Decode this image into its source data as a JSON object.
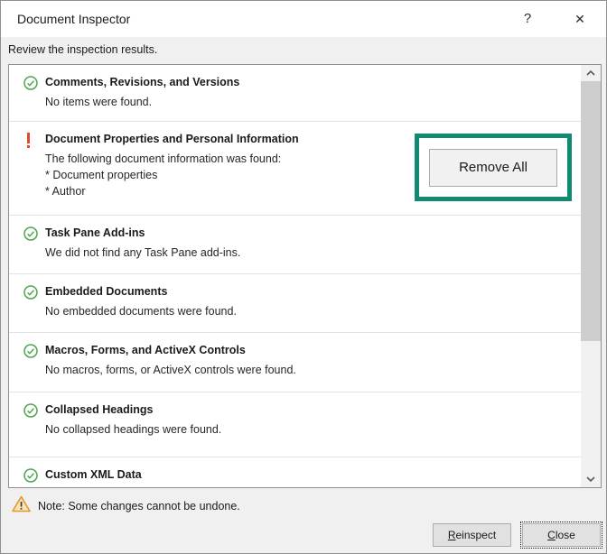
{
  "dialog": {
    "title": "Document Inspector",
    "help_label": "?",
    "close_label": "✕",
    "subtitle": "Review the inspection results."
  },
  "results": [
    {
      "status": "success",
      "title": "Comments, Revisions, and Versions",
      "lines": [
        "No items were found."
      ]
    },
    {
      "status": "alert",
      "title": "Document Properties and Personal Information",
      "lines": [
        "The following document information was found:",
        "* Document properties",
        "* Author"
      ],
      "action_label": "Remove All",
      "highlighted": true
    },
    {
      "status": "success",
      "title": "Task Pane Add-ins",
      "lines": [
        "We did not find any Task Pane add-ins."
      ]
    },
    {
      "status": "success",
      "title": "Embedded Documents",
      "lines": [
        "No embedded documents were found."
      ]
    },
    {
      "status": "success",
      "title": "Macros, Forms, and ActiveX Controls",
      "lines": [
        "No macros, forms, or ActiveX controls were found."
      ]
    },
    {
      "status": "success",
      "title": "Collapsed Headings",
      "lines": [
        "No collapsed headings were found."
      ]
    },
    {
      "status": "success",
      "title": "Custom XML Data",
      "lines": []
    }
  ],
  "note": "Note: Some changes cannot be undone.",
  "footer": {
    "reinspect": {
      "key": "R",
      "rest": "einspect"
    },
    "close": {
      "key": "C",
      "rest": "lose"
    }
  },
  "icons": {
    "success": "check-circle",
    "alert": "exclamation-mark",
    "note": "warning-triangle",
    "scroll_up": "chevron-up",
    "scroll_down": "chevron-down"
  },
  "colors": {
    "success_green": "#4ca64c",
    "alert_red": "#e3492f",
    "annotation_green": "#118a70",
    "warning_orange": "#e19a2e",
    "panel_border": "#8f8f8f",
    "body_background": "#f0f0f0"
  }
}
